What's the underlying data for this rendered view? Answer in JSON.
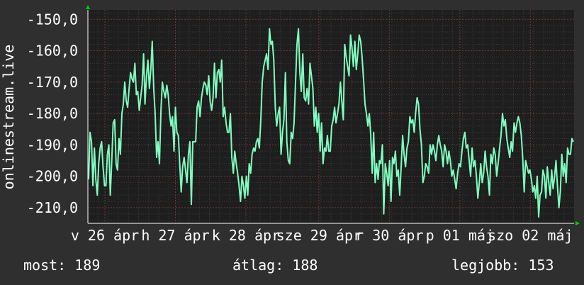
{
  "chart_data": {
    "type": "line",
    "ylabel": "onlinestream.live",
    "ylim": [
      -215,
      -147
    ],
    "yticks": [
      -150,
      -160,
      -170,
      -180,
      -190,
      -200,
      -210
    ],
    "ytick_labels": [
      "-150,0",
      "-160,0",
      "-170,0",
      "-180,0",
      "-190,0",
      "-200,0",
      "-210,0"
    ],
    "xlim": [
      0,
      100
    ],
    "xtick_labels": [
      {
        "x": 3.5,
        "label": "v 26 ápr"
      },
      {
        "x": 18.0,
        "label": "h 27 ápr"
      },
      {
        "x": 32.5,
        "label": "k 28 ápr"
      },
      {
        "x": 47.5,
        "label": "sze 29 ápr"
      },
      {
        "x": 62.0,
        "label": "r 30 ápr"
      },
      {
        "x": 76.5,
        "label": "p 01 máj"
      },
      {
        "x": 91.0,
        "label": "szo 02 máj"
      }
    ],
    "grid": true,
    "line_color": "#7fffc0",
    "series": [
      {
        "values": [
          -201,
          -186,
          -189,
          -203,
          -191,
          -201,
          -206,
          -196,
          -191,
          -189,
          -197,
          -203,
          -203,
          -193,
          -190,
          -206,
          -195,
          -183,
          -182,
          -196,
          -198,
          -188,
          -193,
          -180,
          -177,
          -170,
          -176,
          -178,
          -172,
          -167,
          -169,
          -170,
          -164,
          -174,
          -173,
          -179,
          -175,
          -171,
          -161,
          -177,
          -168,
          -163,
          -172,
          -166,
          -157,
          -172,
          -180,
          -194,
          -189,
          -196,
          -179,
          -170,
          -173,
          -175,
          -171,
          -174,
          -180,
          -184,
          -181,
          -192,
          -178,
          -186,
          -187,
          -196,
          -205,
          -197,
          -194,
          -198,
          -202,
          -193,
          -189,
          -209,
          -189,
          -189,
          -189,
          -178,
          -176,
          -181,
          -175,
          -172,
          -170,
          -171,
          -174,
          -168,
          -176,
          -179,
          -175,
          -164,
          -175,
          -167,
          -166,
          -170,
          -163,
          -181,
          -178,
          -183,
          -186,
          -186,
          -180,
          -194,
          -199,
          -192,
          -196,
          -199,
          -203,
          -208,
          -200,
          -203,
          -207,
          -200,
          -206,
          -196,
          -199,
          -193,
          -191,
          -192,
          -189,
          -188,
          -191,
          -182,
          -170,
          -165,
          -163,
          -161,
          -166,
          -153,
          -158,
          -157,
          -163,
          -178,
          -184,
          -180,
          -178,
          -193,
          -186,
          -182,
          -167,
          -189,
          -195,
          -196,
          -186,
          -188,
          -183,
          -170,
          -158,
          -153,
          -167,
          -173,
          -161,
          -175,
          -176,
          -172,
          -177,
          -164,
          -168,
          -172,
          -184,
          -178,
          -186,
          -180,
          -192,
          -183,
          -196,
          -191,
          -192,
          -187,
          -192,
          -192,
          -184,
          -182,
          -178,
          -183,
          -180,
          -177,
          -170,
          -176,
          -182,
          -158,
          -162,
          -165,
          -168,
          -155,
          -159,
          -165,
          -157,
          -166,
          -161,
          -155,
          -157,
          -162,
          -169,
          -177,
          -180,
          -184,
          -180,
          -187,
          -199,
          -186,
          -202,
          -196,
          -201,
          -195,
          -196,
          -190,
          -212,
          -196,
          -199,
          -203,
          -195,
          -208,
          -194,
          -196,
          -192,
          -200,
          -198,
          -206,
          -197,
          -187,
          -193,
          -197,
          -191,
          -189,
          -181,
          -183,
          -182,
          -186,
          -180,
          -175,
          -177,
          -185,
          -190,
          -202,
          -200,
          -196,
          -197,
          -199,
          -190,
          -193,
          -190,
          -192,
          -195,
          -190,
          -187,
          -190,
          -192,
          -197,
          -190,
          -192,
          -196,
          -192,
          -195,
          -200,
          -198,
          -201,
          -204,
          -199,
          -196,
          -197,
          -192,
          -188,
          -186,
          -191,
          -190,
          -195,
          -200,
          -191,
          -197,
          -195,
          -200,
          -207,
          -202,
          -196,
          -202,
          -199,
          -192,
          -197,
          -200,
          -206,
          -193,
          -196,
          -191,
          -193,
          -200,
          -196,
          -191,
          -187,
          -180,
          -184,
          -182,
          -188,
          -191,
          -194,
          -189,
          -192,
          -183,
          -186,
          -183,
          -181,
          -183,
          -187,
          -194,
          -205,
          -195,
          -197,
          -199,
          -198,
          -201,
          -205,
          -203,
          -207,
          -200,
          -213,
          -206,
          -205,
          -198,
          -200,
          -207,
          -197,
          -202,
          -206,
          -198,
          -204,
          -200,
          -195,
          -203,
          -210,
          -205,
          -193,
          -200,
          -196,
          -202,
          -191,
          -193,
          -193,
          -188,
          -189
        ]
      }
    ]
  },
  "footer": {
    "current": "most: 189",
    "average": "átlag: 188",
    "best": "legjobb: 153"
  }
}
